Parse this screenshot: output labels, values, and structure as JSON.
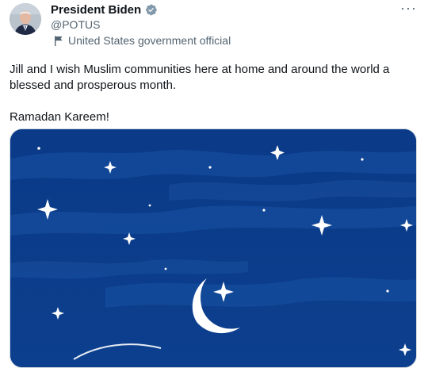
{
  "author": {
    "name": "President Biden",
    "handle": "@POTUS",
    "label": "United States government official",
    "avatar_icon": "avatar-photo",
    "verified_icon": "verified-badge-icon",
    "verified_color": "#829aab"
  },
  "menu": {
    "more_label": "···"
  },
  "tweet": {
    "text_1": "Jill and I wish Muslim communities here at home and around the world a blessed and prosperous month.",
    "text_2": "Ramadan Kareem!"
  },
  "media": {
    "description_icon": "night-sky-crescent-moon-image",
    "sky_color": "#0b3c8a"
  }
}
